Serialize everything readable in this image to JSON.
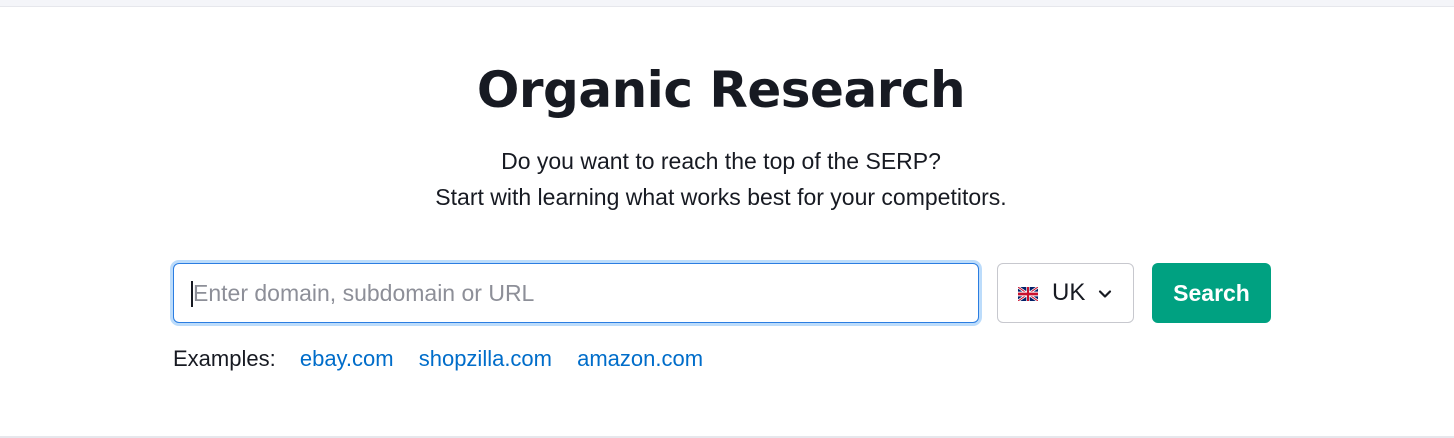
{
  "page": {
    "title": "Organic Research",
    "subtitle_line1": "Do you want to reach the top of the SERP?",
    "subtitle_line2": "Start with learning what works best for your competitors."
  },
  "search": {
    "value": "",
    "placeholder": "Enter domain, subdomain or URL",
    "button_label": "Search"
  },
  "country": {
    "selected": "UK",
    "flag_icon": "uk-flag-icon",
    "dropdown_icon": "chevron-down-icon"
  },
  "examples": {
    "label": "Examples:",
    "links": [
      "ebay.com",
      "shopzilla.com",
      "amazon.com"
    ]
  },
  "colors": {
    "accent_green": "#00a181",
    "link_blue": "#006dca",
    "focus_ring": "#bcdcfb",
    "text_dark": "#171a22"
  }
}
